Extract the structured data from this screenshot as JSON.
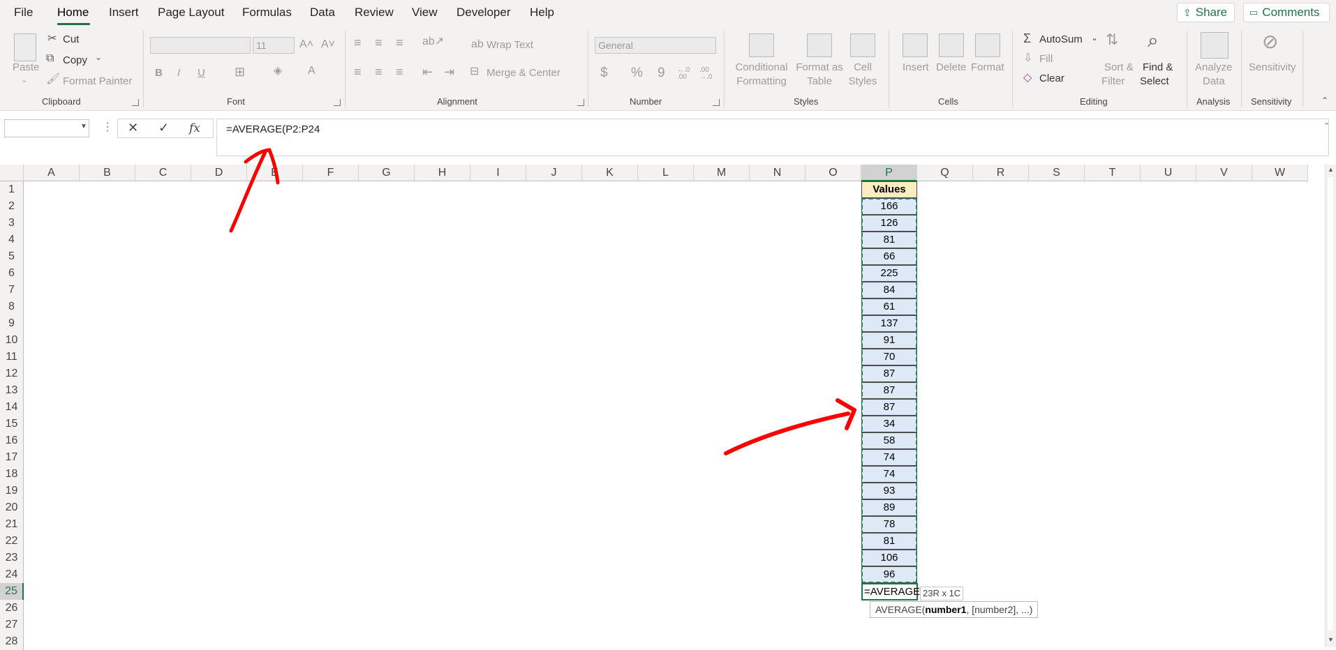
{
  "menu": {
    "items": [
      "File",
      "Home",
      "Insert",
      "Page Layout",
      "Formulas",
      "Data",
      "Review",
      "View",
      "Developer",
      "Help"
    ],
    "active": "Home",
    "share_label": "Share",
    "comments_label": "Comments"
  },
  "ribbon": {
    "clipboard": {
      "label": "Clipboard",
      "paste": "Paste",
      "cut": "Cut",
      "copy": "Copy",
      "format_painter": "Format Painter"
    },
    "font": {
      "label": "Font",
      "font_name": "",
      "font_size": "11",
      "bold": "B",
      "italic": "I",
      "underline": "U"
    },
    "alignment": {
      "label": "Alignment",
      "wrap_text": "Wrap Text",
      "merge_center": "Merge & Center"
    },
    "number": {
      "label": "Number",
      "format": "General",
      "currency": "$",
      "percent": "%",
      "comma": "9",
      "inc_decimal": "←.0 .00",
      "dec_decimal": ".00 →.0"
    },
    "styles": {
      "label": "Styles",
      "conditional_1": "Conditional",
      "conditional_2": "Formatting",
      "format_table_1": "Format as",
      "format_table_2": "Table",
      "cell_styles_1": "Cell",
      "cell_styles_2": "Styles"
    },
    "cells": {
      "label": "Cells",
      "insert": "Insert",
      "delete": "Delete",
      "format": "Format"
    },
    "editing": {
      "label": "Editing",
      "autosum": "AutoSum",
      "fill": "Fill",
      "clear": "Clear",
      "sort_1": "Sort &",
      "sort_2": "Filter",
      "find_1": "Find &",
      "find_2": "Select"
    },
    "analysis": {
      "label": "Analysis",
      "analyze_1": "Analyze",
      "analyze_2": "Data"
    },
    "sensitivity": {
      "label": "Sensitivity",
      "sensitivity_btn": "Sensitivity"
    }
  },
  "formula_bar": {
    "name_box": "",
    "fx": "fx",
    "formula": "=AVERAGE(P2:P24"
  },
  "grid": {
    "columns": [
      "A",
      "B",
      "C",
      "D",
      "E",
      "F",
      "G",
      "H",
      "I",
      "J",
      "K",
      "L",
      "M",
      "N",
      "O",
      "P",
      "Q",
      "R",
      "S",
      "T",
      "U",
      "V",
      "W"
    ],
    "selected_column": "P",
    "rows": [
      "1",
      "2",
      "3",
      "4",
      "5",
      "6",
      "7",
      "8",
      "9",
      "10",
      "11",
      "12",
      "13",
      "14",
      "15",
      "16",
      "17",
      "18",
      "19",
      "20",
      "21",
      "22",
      "23",
      "24",
      "25",
      "26",
      "27",
      "28"
    ],
    "selected_row": "25",
    "p_header": "Values",
    "p_values": [
      "166",
      "126",
      "81",
      "66",
      "225",
      "84",
      "61",
      "137",
      "91",
      "70",
      "87",
      "87",
      "87",
      "34",
      "58",
      "74",
      "74",
      "93",
      "89",
      "78",
      "81",
      "106",
      "96"
    ],
    "active_cell_text": "=AVERAGE(",
    "range_tip": "23R x 1C",
    "func_tip_name": "AVERAGE(",
    "func_tip_arg1": "number1",
    "func_tip_rest": ", [number2], ...)"
  },
  "colors": {
    "accent": "#217346",
    "header_fill": "#fbecc1",
    "value_fill": "#dde9f7",
    "annotation": "#ff0000"
  }
}
